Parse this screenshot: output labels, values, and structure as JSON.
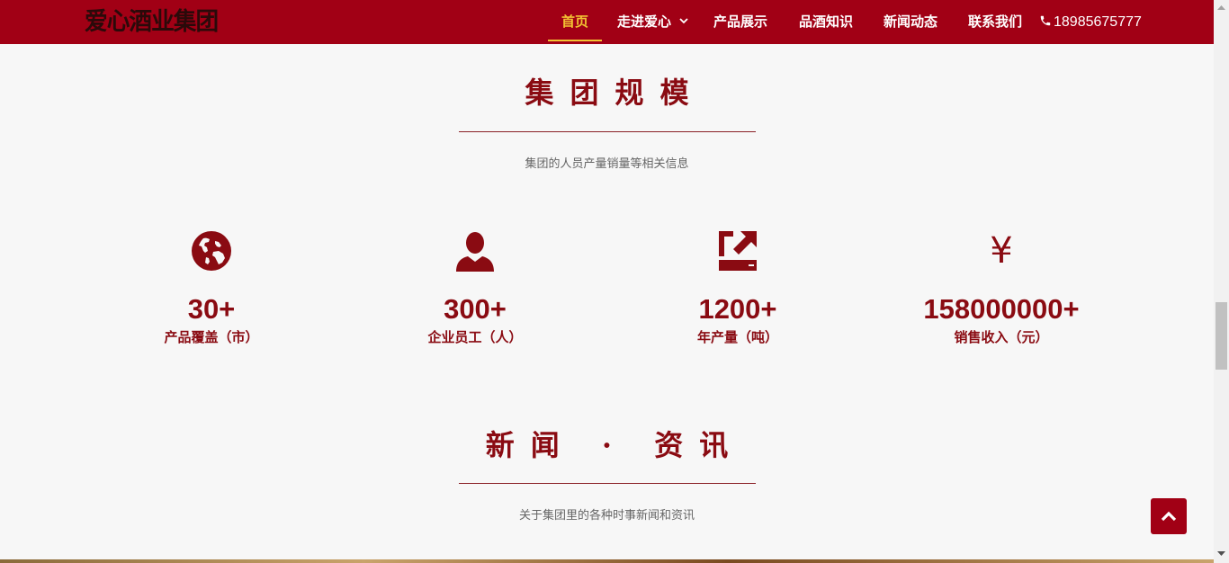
{
  "header": {
    "logo_text": "爱心酒业集团",
    "nav": [
      {
        "label": "首页",
        "active": true
      },
      {
        "label": "走进爱心",
        "has_dropdown": true
      },
      {
        "label": "产品展示"
      },
      {
        "label": "品酒知识"
      },
      {
        "label": "新闻动态"
      },
      {
        "label": "联系我们"
      }
    ],
    "phone": "18985675777"
  },
  "scale_section": {
    "title": "集团规模",
    "subtitle": "集团的人员产量销量等相关信息",
    "stats": [
      {
        "icon": "globe-icon",
        "value": "30+",
        "label": "产品覆盖（市）"
      },
      {
        "icon": "user-icon",
        "value": "300+",
        "label": "企业员工（人）"
      },
      {
        "icon": "upload-icon",
        "value": "1200+",
        "label": "年产量（吨）"
      },
      {
        "icon": "yen-icon",
        "value": "158000000+",
        "label": "销售收入（元）",
        "symbol": "¥"
      }
    ]
  },
  "news_section": {
    "title": "新闻 · 资讯",
    "subtitle": "关于集团里的各种时事新闻和资讯"
  },
  "colors": {
    "brand_red": "#a10015",
    "accent_gold": "#f2c233",
    "text_dark_red": "#8a0b12"
  }
}
